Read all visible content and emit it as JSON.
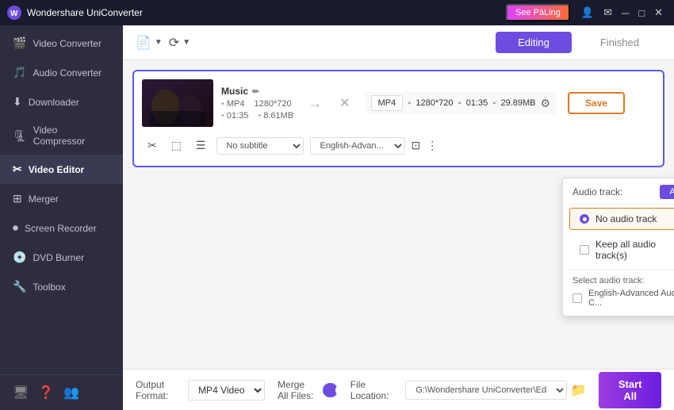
{
  "app": {
    "title": "Wondershare UniConverter",
    "promo_label": "See PàLing"
  },
  "sidebar": {
    "items": [
      {
        "label": "Video Converter",
        "icon": "🎬",
        "active": false
      },
      {
        "label": "Audio Converter",
        "icon": "🎵",
        "active": false
      },
      {
        "label": "Downloader",
        "icon": "⬇",
        "active": false
      },
      {
        "label": "Video Compressor",
        "icon": "🗜",
        "active": false
      },
      {
        "label": "Video Editor",
        "icon": "✂",
        "active": true
      },
      {
        "label": "Merger",
        "icon": "⊞",
        "active": false
      },
      {
        "label": "Screen Recorder",
        "icon": "⏺",
        "active": false
      },
      {
        "label": "DVD Burner",
        "icon": "💿",
        "active": false
      },
      {
        "label": "Toolbox",
        "icon": "🔧",
        "active": false
      }
    ]
  },
  "tabs": {
    "editing_label": "Editing",
    "finished_label": "Finished"
  },
  "file": {
    "name": "Music",
    "format": "MP4",
    "resolution": "1280*720",
    "duration": "01:35",
    "size": "8.61MB",
    "output_format": "MP4",
    "output_resolution": "1280*720",
    "output_duration": "01:35",
    "output_size": "29.89MB"
  },
  "edit_tools": {
    "subtitle_placeholder": "No subtitle",
    "audio_placeholder": "English-Advan..."
  },
  "audio_dropdown": {
    "label": "Audio track:",
    "add_label": "Add",
    "no_audio_label": "No audio track",
    "keep_audio_label": "Keep all audio track(s)",
    "select_audio_label": "Select audio track:",
    "audio_track_name": "English-Advanced Audio C..."
  },
  "bottom": {
    "output_format_label": "Output Format:",
    "output_format_value": "MP4 Video",
    "merge_label": "Merge All Files:",
    "file_location_label": "File Location:",
    "file_location_path": "G:\\Wondershare UniConverter\\Edited",
    "start_all_label": "Start All"
  }
}
